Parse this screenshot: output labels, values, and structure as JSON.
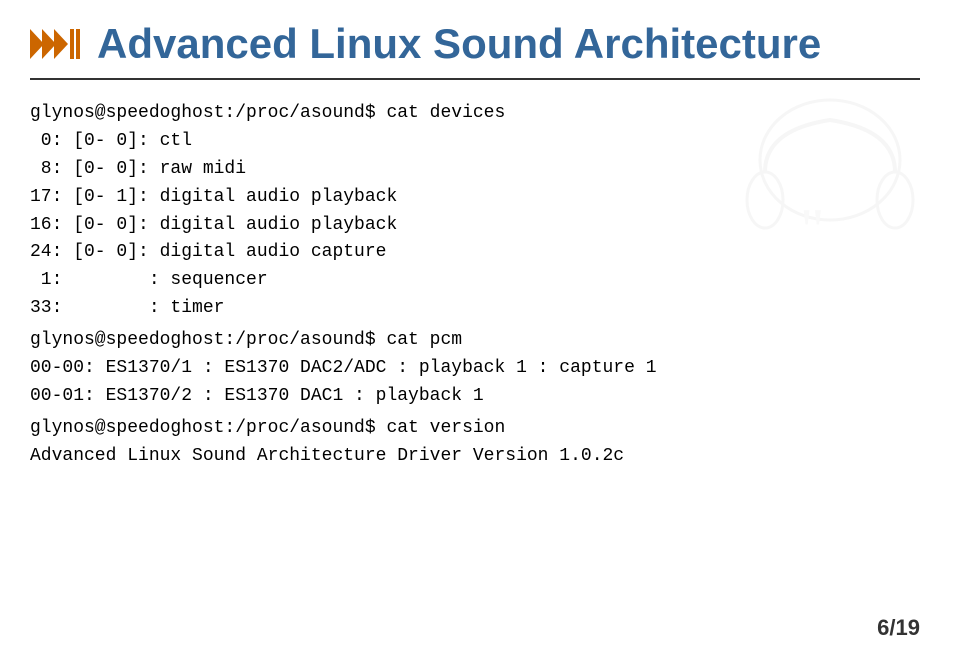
{
  "header": {
    "title": "Advanced Linux Sound Architecture",
    "icon_label": "arrow-icon"
  },
  "terminal_blocks": [
    {
      "id": "block1",
      "lines": [
        "glynos@speedoghost:/proc/asound$ cat devices",
        " 0: [0- 0]: ctl",
        " 8: [0- 0]: raw midi",
        "17: [0- 1]: digital audio playback",
        "16: [0- 0]: digital audio playback",
        "24: [0- 0]: digital audio capture",
        " 1:        : sequencer",
        "33:        : timer"
      ]
    },
    {
      "id": "block2",
      "lines": [
        "glynos@speedoghost:/proc/asound$ cat pcm",
        "00-00: ES1370/1 : ES1370 DAC2/ADC : playback 1 : capture 1",
        "00-01: ES1370/2 : ES1370 DAC1 : playback 1"
      ]
    },
    {
      "id": "block3",
      "lines": [
        "glynos@speedoghost:/proc/asound$ cat version",
        "Advanced Linux Sound Architecture Driver Version 1.0.2c"
      ]
    }
  ],
  "page_number": {
    "current": "6",
    "total": "19",
    "display": "6/19"
  }
}
